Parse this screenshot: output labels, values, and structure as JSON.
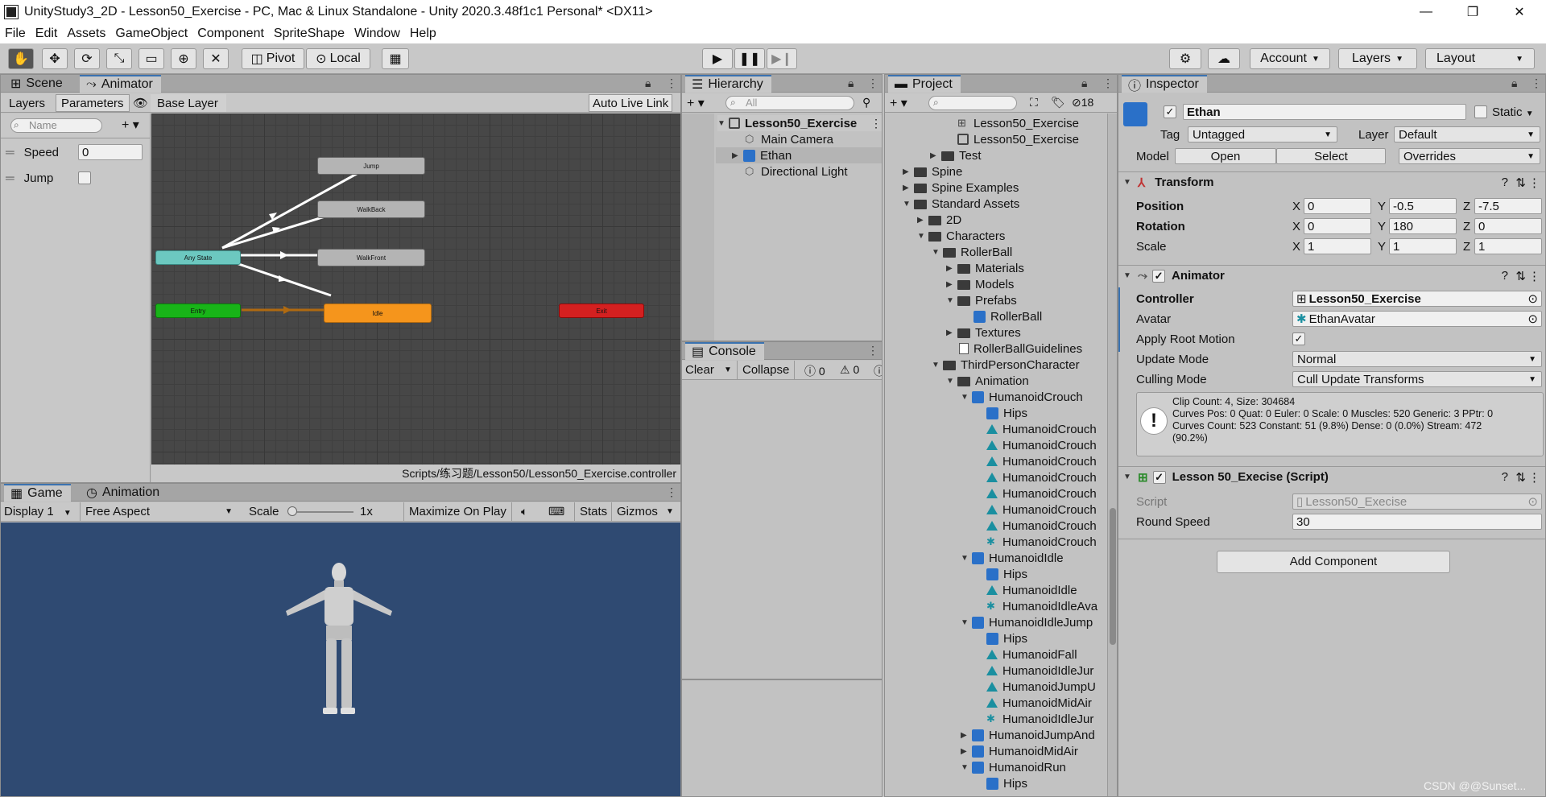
{
  "window": {
    "title": "UnityStudy3_2D - Lesson50_Exercise - PC, Mac & Linux Standalone - Unity 2020.3.48f1c1 Personal* <DX11>",
    "minimize": "—",
    "maximize": "❐",
    "close": "✕"
  },
  "menu": [
    "File",
    "Edit",
    "Assets",
    "GameObject",
    "Component",
    "SpriteShape",
    "Window",
    "Help"
  ],
  "toolbar": {
    "pivot": "Pivot",
    "local": "Local",
    "account": "Account",
    "layers": "Layers",
    "layout": "Layout"
  },
  "animator_panel": {
    "tabs": [
      "Scene",
      "Animator"
    ],
    "sub_tabs": [
      "Layers",
      "Parameters"
    ],
    "base_layer": "Base Layer",
    "auto_live_link": "Auto Live Link",
    "search_placeholder": "Name",
    "parameters": [
      {
        "name": "Speed",
        "value": "0"
      },
      {
        "name": "Jump",
        "value": ""
      }
    ],
    "nodes": {
      "jump": "Jump",
      "walkback": "WalkBack",
      "walkfront": "WalkFront",
      "anystate": "Any State",
      "entry": "Entry",
      "idle": "Idle",
      "exit": "Exit"
    },
    "path": "Scripts/练习题/Lesson50/Lesson50_Exercise.controller"
  },
  "game_panel": {
    "tabs": [
      "Game",
      "Animation"
    ],
    "display": "Display 1",
    "aspect": "Free Aspect",
    "scale_label": "Scale",
    "scale_value": "1x",
    "maximize": "Maximize On Play",
    "stats": "Stats",
    "gizmos": "Gizmos"
  },
  "hierarchy": {
    "tab": "Hierarchy",
    "search_placeholder": "All",
    "items": [
      "Lesson50_Exercise",
      "Main Camera",
      "Ethan",
      "Directional Light"
    ]
  },
  "console": {
    "tab": "Console",
    "clear": "Clear",
    "collapse": "Collapse",
    "err_count": "0",
    "warn_count": "0"
  },
  "project": {
    "tab": "Project",
    "hidden_count": "18",
    "items": [
      {
        "label": "Lesson50_Exercise"
      },
      {
        "label": "Lesson50_Exercise"
      },
      {
        "label": "Test"
      },
      {
        "label": "Spine"
      },
      {
        "label": "Spine Examples"
      },
      {
        "label": "Standard Assets"
      },
      {
        "label": "2D"
      },
      {
        "label": "Characters"
      },
      {
        "label": "RollerBall"
      },
      {
        "label": "Materials"
      },
      {
        "label": "Models"
      },
      {
        "label": "Prefabs"
      },
      {
        "label": "RollerBall"
      },
      {
        "label": "Textures"
      },
      {
        "label": "RollerBallGuidelines"
      },
      {
        "label": "ThirdPersonCharacter"
      },
      {
        "label": "Animation"
      },
      {
        "label": "HumanoidCrouch"
      },
      {
        "label": "Hips"
      },
      {
        "label": "HumanoidCrouch"
      },
      {
        "label": "HumanoidCrouch"
      },
      {
        "label": "HumanoidCrouch"
      },
      {
        "label": "HumanoidCrouch"
      },
      {
        "label": "HumanoidCrouch"
      },
      {
        "label": "HumanoidCrouch"
      },
      {
        "label": "HumanoidCrouch"
      },
      {
        "label": "HumanoidCrouch"
      },
      {
        "label": "HumanoidIdle"
      },
      {
        "label": "Hips"
      },
      {
        "label": "HumanoidIdle"
      },
      {
        "label": "HumanoidIdleAva"
      },
      {
        "label": "HumanoidIdleJump"
      },
      {
        "label": "Hips"
      },
      {
        "label": "HumanoidFall"
      },
      {
        "label": "HumanoidIdleJur"
      },
      {
        "label": "HumanoidJumpU"
      },
      {
        "label": "HumanoidMidAir"
      },
      {
        "label": "HumanoidIdleJur"
      },
      {
        "label": "HumanoidJumpAnd"
      },
      {
        "label": "HumanoidMidAir"
      },
      {
        "label": "HumanoidRun"
      },
      {
        "label": "Hips"
      }
    ]
  },
  "inspector": {
    "tab": "Inspector",
    "object_name": "Ethan",
    "static_label": "Static",
    "tag_label": "Tag",
    "tag_value": "Untagged",
    "layer_label": "Layer",
    "layer_value": "Default",
    "model_label": "Model",
    "open": "Open",
    "select": "Select",
    "overrides": "Overrides",
    "transform": {
      "header": "Transform",
      "position_label": "Position",
      "position": [
        "0",
        "-0.5",
        "-7.5"
      ],
      "rotation_label": "Rotation",
      "rotation": [
        "0",
        "180",
        "0"
      ],
      "scale_label": "Scale",
      "scale": [
        "1",
        "1",
        "1"
      ]
    },
    "animator": {
      "header": "Animator",
      "controller_label": "Controller",
      "controller_value": "Lesson50_Exercise",
      "avatar_label": "Avatar",
      "avatar_value": "EthanAvatar",
      "root_motion_label": "Apply Root Motion",
      "update_mode_label": "Update Mode",
      "update_mode_value": "Normal",
      "culling_label": "Culling Mode",
      "culling_value": "Cull Update Transforms",
      "info": [
        "Clip Count: 4, Size: 304684",
        "Curves Pos: 0 Quat: 0 Euler: 0 Scale: 0 Muscles: 520 Generic: 3 PPtr: 0",
        "Curves Count: 523 Constant: 51 (9.8%) Dense: 0 (0.0%) Stream: 472",
        "(90.2%)"
      ]
    },
    "script": {
      "header": "Lesson 50_Execise (Script)",
      "script_label": "Script",
      "script_value": "Lesson50_Execise",
      "round_speed_label": "Round Speed",
      "round_speed_value": "30"
    },
    "add_component": "Add Component"
  },
  "watermark": "CSDN @@Sunset..."
}
